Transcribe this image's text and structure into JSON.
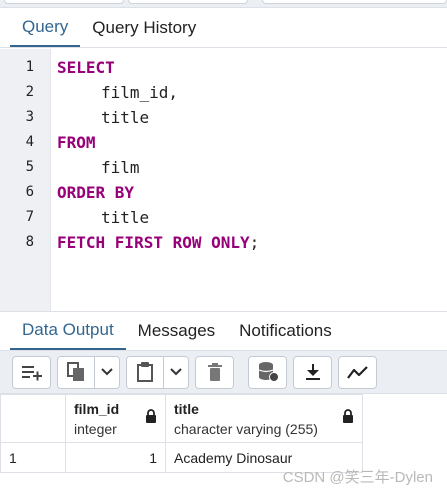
{
  "editor_tabs": [
    {
      "label": "Query",
      "active": true
    },
    {
      "label": "Query History",
      "active": false
    }
  ],
  "editor": {
    "line_numbers": [
      "1",
      "2",
      "3",
      "4",
      "5",
      "6",
      "7",
      "8"
    ],
    "lines": [
      {
        "keyword": "SELECT",
        "text": ""
      },
      {
        "keyword": "",
        "text": "film_id,"
      },
      {
        "keyword": "",
        "text": "title"
      },
      {
        "keyword": "FROM",
        "text": ""
      },
      {
        "keyword": "",
        "text": "film"
      },
      {
        "keyword": "ORDER BY",
        "text": ""
      },
      {
        "keyword": "",
        "text": "title"
      },
      {
        "keyword": "FETCH FIRST ROW ONLY",
        "text": ";"
      }
    ]
  },
  "output_tabs": [
    {
      "label": "Data Output",
      "active": true
    },
    {
      "label": "Messages",
      "active": false
    },
    {
      "label": "Notifications",
      "active": false
    }
  ],
  "toolbar": {
    "icons": [
      "add-row-icon",
      "copy-icon",
      "chevron-down-icon",
      "paste-icon",
      "chevron-down-icon",
      "delete-icon",
      "save-data-icon",
      "download-icon",
      "graph-icon"
    ]
  },
  "grid": {
    "columns": [
      {
        "name": "film_id",
        "type": "integer",
        "locked": true
      },
      {
        "name": "title",
        "type": "character varying (255)",
        "locked": true
      }
    ],
    "rows": [
      {
        "rownum": "1",
        "film_id": "1",
        "title": "Academy Dinosaur"
      }
    ]
  },
  "watermark": "CSDN @笑三年-Dylen",
  "colors": {
    "accent": "#326690",
    "keyword": "#970079",
    "toolbar_bg": "#ebeef3",
    "gutter_bg": "#eef0f4"
  }
}
